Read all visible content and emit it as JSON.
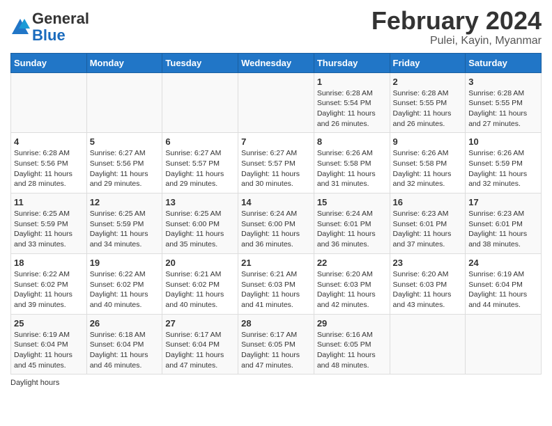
{
  "logo": {
    "general": "General",
    "blue": "Blue"
  },
  "title": "February 2024",
  "subtitle": "Pulei, Kayin, Myanmar",
  "footer_label": "Daylight hours",
  "days_of_week": [
    "Sunday",
    "Monday",
    "Tuesday",
    "Wednesday",
    "Thursday",
    "Friday",
    "Saturday"
  ],
  "weeks": [
    [
      {
        "num": "",
        "sunrise": "",
        "sunset": "",
        "daylight": ""
      },
      {
        "num": "",
        "sunrise": "",
        "sunset": "",
        "daylight": ""
      },
      {
        "num": "",
        "sunrise": "",
        "sunset": "",
        "daylight": ""
      },
      {
        "num": "",
        "sunrise": "",
        "sunset": "",
        "daylight": ""
      },
      {
        "num": "1",
        "sunrise": "Sunrise: 6:28 AM",
        "sunset": "Sunset: 5:54 PM",
        "daylight": "Daylight: 11 hours and 26 minutes."
      },
      {
        "num": "2",
        "sunrise": "Sunrise: 6:28 AM",
        "sunset": "Sunset: 5:55 PM",
        "daylight": "Daylight: 11 hours and 26 minutes."
      },
      {
        "num": "3",
        "sunrise": "Sunrise: 6:28 AM",
        "sunset": "Sunset: 5:55 PM",
        "daylight": "Daylight: 11 hours and 27 minutes."
      }
    ],
    [
      {
        "num": "4",
        "sunrise": "Sunrise: 6:28 AM",
        "sunset": "Sunset: 5:56 PM",
        "daylight": "Daylight: 11 hours and 28 minutes."
      },
      {
        "num": "5",
        "sunrise": "Sunrise: 6:27 AM",
        "sunset": "Sunset: 5:56 PM",
        "daylight": "Daylight: 11 hours and 29 minutes."
      },
      {
        "num": "6",
        "sunrise": "Sunrise: 6:27 AM",
        "sunset": "Sunset: 5:57 PM",
        "daylight": "Daylight: 11 hours and 29 minutes."
      },
      {
        "num": "7",
        "sunrise": "Sunrise: 6:27 AM",
        "sunset": "Sunset: 5:57 PM",
        "daylight": "Daylight: 11 hours and 30 minutes."
      },
      {
        "num": "8",
        "sunrise": "Sunrise: 6:26 AM",
        "sunset": "Sunset: 5:58 PM",
        "daylight": "Daylight: 11 hours and 31 minutes."
      },
      {
        "num": "9",
        "sunrise": "Sunrise: 6:26 AM",
        "sunset": "Sunset: 5:58 PM",
        "daylight": "Daylight: 11 hours and 32 minutes."
      },
      {
        "num": "10",
        "sunrise": "Sunrise: 6:26 AM",
        "sunset": "Sunset: 5:59 PM",
        "daylight": "Daylight: 11 hours and 32 minutes."
      }
    ],
    [
      {
        "num": "11",
        "sunrise": "Sunrise: 6:25 AM",
        "sunset": "Sunset: 5:59 PM",
        "daylight": "Daylight: 11 hours and 33 minutes."
      },
      {
        "num": "12",
        "sunrise": "Sunrise: 6:25 AM",
        "sunset": "Sunset: 5:59 PM",
        "daylight": "Daylight: 11 hours and 34 minutes."
      },
      {
        "num": "13",
        "sunrise": "Sunrise: 6:25 AM",
        "sunset": "Sunset: 6:00 PM",
        "daylight": "Daylight: 11 hours and 35 minutes."
      },
      {
        "num": "14",
        "sunrise": "Sunrise: 6:24 AM",
        "sunset": "Sunset: 6:00 PM",
        "daylight": "Daylight: 11 hours and 36 minutes."
      },
      {
        "num": "15",
        "sunrise": "Sunrise: 6:24 AM",
        "sunset": "Sunset: 6:01 PM",
        "daylight": "Daylight: 11 hours and 36 minutes."
      },
      {
        "num": "16",
        "sunrise": "Sunrise: 6:23 AM",
        "sunset": "Sunset: 6:01 PM",
        "daylight": "Daylight: 11 hours and 37 minutes."
      },
      {
        "num": "17",
        "sunrise": "Sunrise: 6:23 AM",
        "sunset": "Sunset: 6:01 PM",
        "daylight": "Daylight: 11 hours and 38 minutes."
      }
    ],
    [
      {
        "num": "18",
        "sunrise": "Sunrise: 6:22 AM",
        "sunset": "Sunset: 6:02 PM",
        "daylight": "Daylight: 11 hours and 39 minutes."
      },
      {
        "num": "19",
        "sunrise": "Sunrise: 6:22 AM",
        "sunset": "Sunset: 6:02 PM",
        "daylight": "Daylight: 11 hours and 40 minutes."
      },
      {
        "num": "20",
        "sunrise": "Sunrise: 6:21 AM",
        "sunset": "Sunset: 6:02 PM",
        "daylight": "Daylight: 11 hours and 40 minutes."
      },
      {
        "num": "21",
        "sunrise": "Sunrise: 6:21 AM",
        "sunset": "Sunset: 6:03 PM",
        "daylight": "Daylight: 11 hours and 41 minutes."
      },
      {
        "num": "22",
        "sunrise": "Sunrise: 6:20 AM",
        "sunset": "Sunset: 6:03 PM",
        "daylight": "Daylight: 11 hours and 42 minutes."
      },
      {
        "num": "23",
        "sunrise": "Sunrise: 6:20 AM",
        "sunset": "Sunset: 6:03 PM",
        "daylight": "Daylight: 11 hours and 43 minutes."
      },
      {
        "num": "24",
        "sunrise": "Sunrise: 6:19 AM",
        "sunset": "Sunset: 6:04 PM",
        "daylight": "Daylight: 11 hours and 44 minutes."
      }
    ],
    [
      {
        "num": "25",
        "sunrise": "Sunrise: 6:19 AM",
        "sunset": "Sunset: 6:04 PM",
        "daylight": "Daylight: 11 hours and 45 minutes."
      },
      {
        "num": "26",
        "sunrise": "Sunrise: 6:18 AM",
        "sunset": "Sunset: 6:04 PM",
        "daylight": "Daylight: 11 hours and 46 minutes."
      },
      {
        "num": "27",
        "sunrise": "Sunrise: 6:17 AM",
        "sunset": "Sunset: 6:04 PM",
        "daylight": "Daylight: 11 hours and 47 minutes."
      },
      {
        "num": "28",
        "sunrise": "Sunrise: 6:17 AM",
        "sunset": "Sunset: 6:05 PM",
        "daylight": "Daylight: 11 hours and 47 minutes."
      },
      {
        "num": "29",
        "sunrise": "Sunrise: 6:16 AM",
        "sunset": "Sunset: 6:05 PM",
        "daylight": "Daylight: 11 hours and 48 minutes."
      },
      {
        "num": "",
        "sunrise": "",
        "sunset": "",
        "daylight": ""
      },
      {
        "num": "",
        "sunrise": "",
        "sunset": "",
        "daylight": ""
      }
    ]
  ]
}
